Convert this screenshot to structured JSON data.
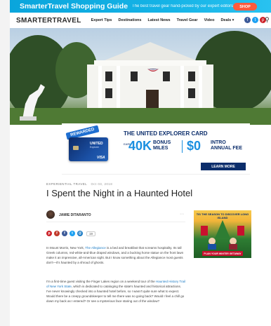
{
  "promo": {
    "title": "SmarterTravel Shopping Guide",
    "text": "The best travel gear hand-picked by our expert editors",
    "button": "SHOP"
  },
  "nav": {
    "logo": "SMARTERTRAVEL",
    "links": [
      "Expert Tips",
      "Destinations",
      "Latest News",
      "Travel Gear",
      "Video",
      "Deals ▾"
    ],
    "icons": [
      "facebook-icon",
      "twitter-icon",
      "pinterest-icon",
      "search-icon"
    ]
  },
  "ad": {
    "ribbon": "REWARDED",
    "title": "THE UNITED EXPLORER CARD",
    "earn": "EARN",
    "bonus_number": "40K",
    "bonus_label_1": "BONUS",
    "bonus_label_2": "MILES",
    "fee_number": "$0",
    "fee_label_1": "INTRO",
    "fee_label_2": "ANNUAL FEE",
    "cta": "LEARN MORE",
    "card_brand": "UNITED",
    "card_sub": "Explorer",
    "card_network": "VISA",
    "colors": {
      "navy": "#0b2d6b",
      "blue": "#1b8fe0"
    }
  },
  "article": {
    "category": "EXPERIENTIAL TRAVEL",
    "date": "Oct 03, 2018",
    "headline": "I Spent the Night in a Haunted Hotel",
    "author": "JAMIE DITARANTO",
    "share_count": "19",
    "p1_before": "In Mount Morris, New York, ",
    "p1_link": "The Allegiance",
    "p1_after": " is a bed and breakfast that screams hospitality. Its tall Greek columns, red-white-and-blue draped windows, and a bucking horse statue on the front lawn make it an impressive, all-American sight. But I know something about the Allegiance most guests don't—it's haunted by a shroud of ghosts.",
    "p2_before": "I'm a first-time guest visiting the Finger Lakes region on a weekend tour of the ",
    "p2_link": "Haunted History Trail of New York State",
    "p2_after": ", which is dedicated to cataloging the state's haunted and historical attractions. I've never knowingly checked into a haunted hotel before, so I wasn't quite sure what to expect. Would there be a creepy groundskeeper to tell me there was no going back? Would I feel a chill go down my back as I entered? Or see a mysterious face staring out of the window?"
  },
  "side_ad": {
    "text": "TIS THE SEASON TO DISCOVER LONG ISLAND",
    "cta": "PLAN YOUR WINTER GETAWAY"
  }
}
